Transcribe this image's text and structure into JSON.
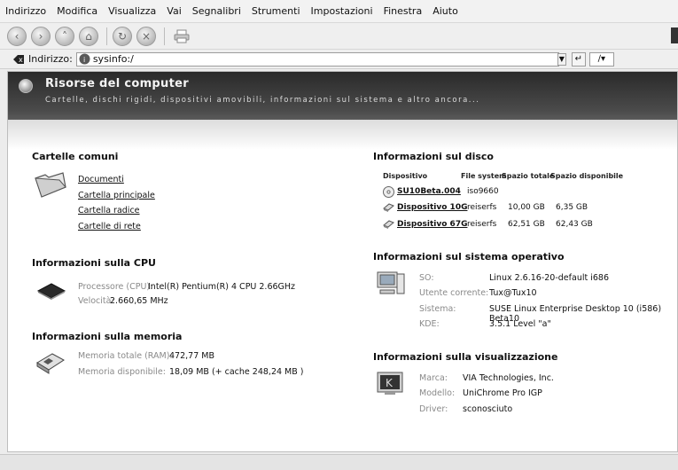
{
  "menu": [
    "Indirizzo",
    "Modifica",
    "Visualizza",
    "Vai",
    "Segnalibri",
    "Strumenti",
    "Impostazioni",
    "Finestra",
    "Aiuto"
  ],
  "address": {
    "label": "Indirizzo:",
    "url": "sysinfo:/"
  },
  "banner": {
    "title": "Risorse del computer",
    "subtitle": "Cartelle, dischi rigidi, dispositivi amovibili, informazioni sul sistema e altro ancora..."
  },
  "folders": {
    "title": "Cartelle comuni",
    "links": [
      "Documenti",
      "Cartella principale",
      "Cartella radice",
      "Cartelle di rete"
    ]
  },
  "cpu": {
    "title": "Informazioni sulla CPU",
    "processor_label": "Processore (CPU):",
    "processor_value": "Intel(R) Pentium(R) 4 CPU 2.66GHz",
    "speed_label": "Velocità:",
    "speed_value": "2.660,65 MHz"
  },
  "memory": {
    "title": "Informazioni sulla memoria",
    "total_label": "Memoria totale (RAM):",
    "total_value": "472,77 MB",
    "free_label": "Memoria disponibile:",
    "free_value": "18,09 MB (+ cache 248,24 MB )"
  },
  "disk": {
    "title": "Informazioni sul disco",
    "headers": [
      "Dispositivo",
      "File system",
      "Spazio totale",
      "Spazio disponibile"
    ],
    "rows": [
      {
        "device": "SU10Beta.004",
        "fs": "iso9660",
        "total": "",
        "free": ""
      },
      {
        "device": "Dispositivo 10G",
        "fs": "reiserfs",
        "total": "10,00 GB",
        "free": "6,35 GB"
      },
      {
        "device": "Dispositivo 67G",
        "fs": "reiserfs",
        "total": "62,51 GB",
        "free": "62,43 GB"
      }
    ]
  },
  "os": {
    "title": "Informazioni sul sistema operativo",
    "so_label": "SO:",
    "so_value": "Linux 2.6.16-20-default i686",
    "user_label": "Utente corrente:",
    "user_value": "Tux@Tux10",
    "system_label": "Sistema:",
    "system_value": "SUSE Linux Enterprise Desktop 10 (i586) Beta10",
    "kde_label": "KDE:",
    "kde_value": "3.5.1 Level \"a\""
  },
  "display": {
    "title": "Informazioni sulla visualizzazione",
    "brand_label": "Marca:",
    "brand_value": "VIA Technologies, Inc.",
    "model_label": "Modello:",
    "model_value": "UniChrome Pro IGP",
    "driver_label": "Driver:",
    "driver_value": "sconosciuto"
  }
}
